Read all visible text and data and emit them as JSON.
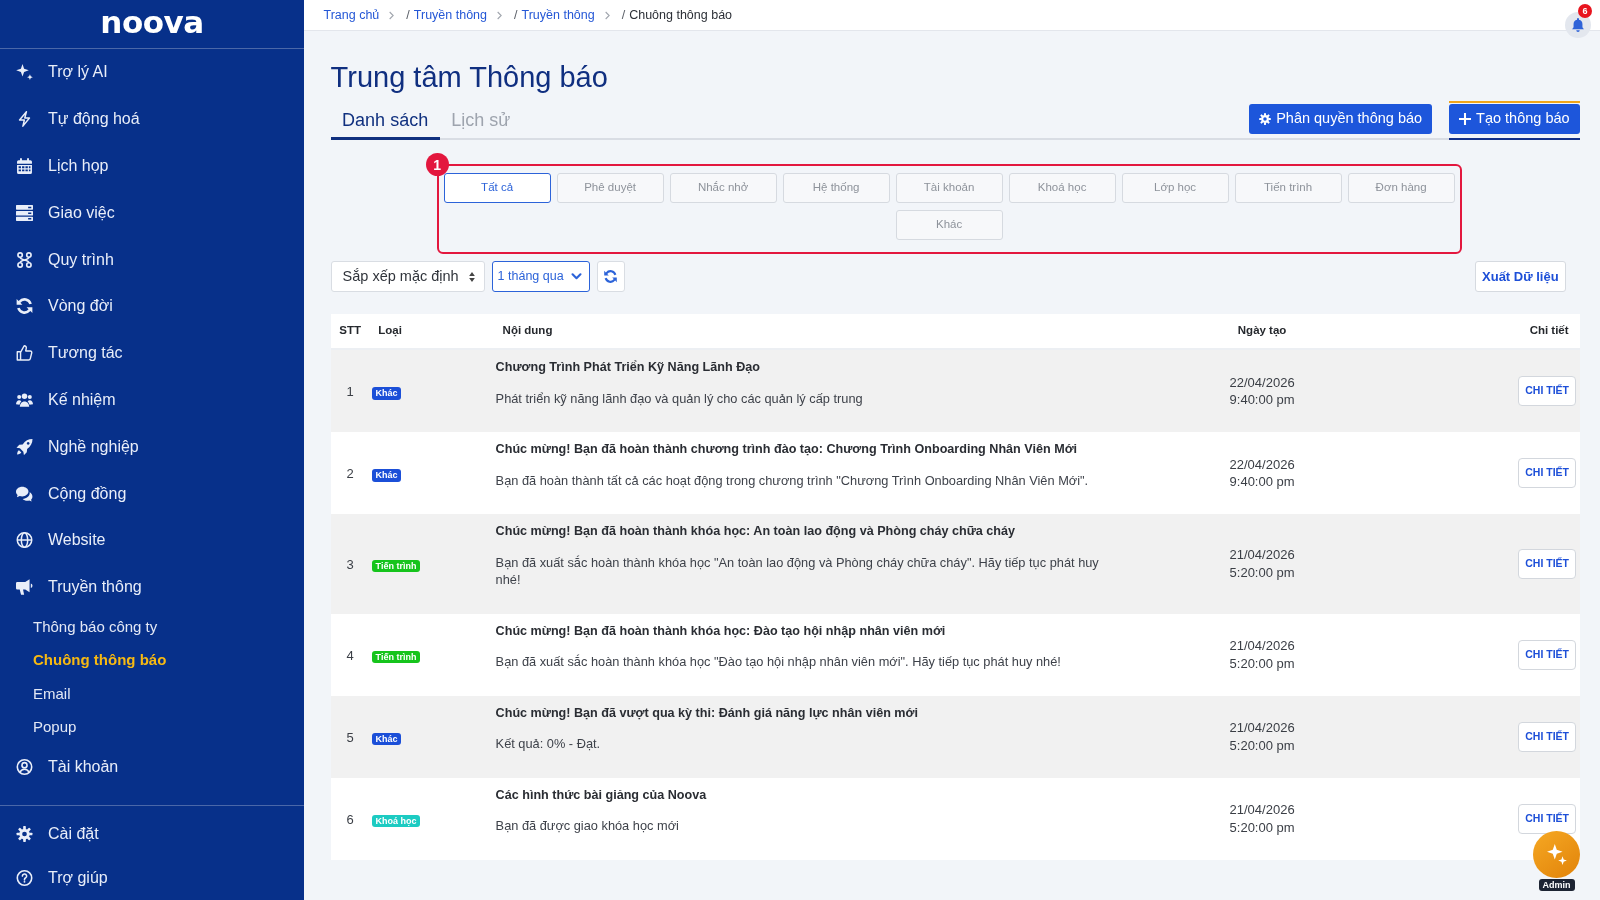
{
  "sidebar": {
    "logo": "noova",
    "items": [
      {
        "label": "Trợ lý AI",
        "selected": false
      },
      {
        "label": "Tự động hoá",
        "selected": false
      },
      {
        "label": "Lịch họp",
        "selected": false
      },
      {
        "label": "Giao việc",
        "selected": false
      },
      {
        "label": "Quy trình",
        "selected": false
      },
      {
        "label": "Vòng đời",
        "selected": false
      },
      {
        "label": "Tương tác",
        "selected": false
      },
      {
        "label": "Kế nhiệm",
        "selected": false
      },
      {
        "label": "Nghề nghiệp",
        "selected": false
      },
      {
        "label": "Cộng đồng",
        "selected": false
      },
      {
        "label": "Website",
        "selected": false
      },
      {
        "label": "Truyền thông",
        "selected": false,
        "children": [
          {
            "label": "Thông báo công ty",
            "selected": false
          },
          {
            "label": "Chuông thông báo",
            "selected": true
          },
          {
            "label": "Email",
            "selected": false
          },
          {
            "label": "Popup",
            "selected": false
          }
        ]
      },
      {
        "label": "Tài khoản",
        "selected": false
      }
    ],
    "bottom_items": [
      {
        "label": "Cài đặt",
        "selected": false
      },
      {
        "label": "Trợ giúp",
        "selected": false
      }
    ]
  },
  "breadcrumb": [
    {
      "label": "Trang chủ",
      "current": false
    },
    {
      "separator": "/",
      "label": "Truyền thông",
      "current": false
    },
    {
      "separator": "/",
      "label": "Truyền thông",
      "current": false
    },
    {
      "separator": "/",
      "label": "Chuông thông báo",
      "current": true
    }
  ],
  "notifications": {
    "count": "6"
  },
  "title": "Trung tâm Thông báo",
  "tabs": [
    {
      "label": "Danh sách",
      "selected": true
    },
    {
      "label": "Lịch sử",
      "selected": false
    }
  ],
  "actions": [
    {
      "label": "Phân quyền thông báo"
    },
    {
      "label": "Tạo thông báo"
    }
  ],
  "filter_panel": {
    "step": "1",
    "filters": [
      {
        "label": "Tất cả",
        "selected": true
      },
      {
        "label": "Phê duyệt",
        "selected": false
      },
      {
        "label": "Nhắc nhở",
        "selected": false
      },
      {
        "label": "Hệ thống",
        "selected": false
      },
      {
        "label": "Tài khoản",
        "selected": false
      },
      {
        "label": "Khoá học",
        "selected": false
      },
      {
        "label": "Lớp học",
        "selected": false
      },
      {
        "label": "Tiến trình",
        "selected": false
      },
      {
        "label": "Đơn hàng",
        "selected": false
      },
      {
        "label": "Khác",
        "selected": false
      }
    ]
  },
  "toolbar": {
    "sort": {
      "value": "Sắp xếp mặc định"
    },
    "period": {
      "value": "1 tháng qua"
    },
    "export_button": "Xuất Dữ liệu"
  },
  "table": {
    "columns": [
      "STT",
      "Loại",
      "Nội dung",
      "Ngày tạo",
      "Chi tiết"
    ],
    "rows": [
      {
        "number": "1",
        "type": {
          "label": "Khác",
          "color": "#1b4fd8"
        },
        "title": "Chương Trình Phát Triển Kỹ Năng Lãnh Đạo",
        "message": "Phát triển kỹ năng lãnh đạo và quản lý cho các quản lý cấp trung",
        "date": "22/04/2026",
        "time": "9:40:00 pm",
        "action": "CHI TIẾT"
      },
      {
        "number": "2",
        "type": {
          "label": "Khác",
          "color": "#1b4fd8"
        },
        "title": "Chúc mừng! Bạn đã hoàn thành chương trình đào tạo: Chương Trình Onboarding Nhân Viên Mới",
        "message": "Bạn đã hoàn thành tất cả các hoạt động trong chương trình \"Chương Trình Onboarding Nhân Viên Mới\".",
        "date": "22/04/2026",
        "time": "9:40:00 pm",
        "action": "CHI TIẾT"
      },
      {
        "number": "3",
        "type": {
          "label": "Tiến trình",
          "color": "#16c41c"
        },
        "title": "Chúc mừng! Bạn đã hoàn thành khóa học: An toàn lao động và Phòng cháy chữa cháy",
        "message": "Bạn đã xuất sắc hoàn thành khóa học \"An toàn lao động và Phòng cháy chữa cháy\". Hãy tiếp tục phát huy nhé!",
        "date": "21/04/2026",
        "time": "5:20:00 pm",
        "action": "CHI TIẾT"
      },
      {
        "number": "4",
        "type": {
          "label": "Tiến trình",
          "color": "#16c41c"
        },
        "title": "Chúc mừng! Bạn đã hoàn thành khóa học: Đào tạo hội nhập nhân viên mới",
        "message": "Bạn đã xuất sắc hoàn thành khóa học \"Đào tạo hội nhập nhân viên mới\". Hãy tiếp tục phát huy nhé!",
        "date": "21/04/2026",
        "time": "5:20:00 pm",
        "action": "CHI TIẾT"
      },
      {
        "number": "5",
        "type": {
          "label": "Khác",
          "color": "#1b4fd8"
        },
        "title": "Chúc mừng! Bạn đã vượt qua kỳ thi: Đánh giá năng lực nhân viên mới",
        "message": "Kết quả: 0% - Đạt.",
        "date": "21/04/2026",
        "time": "5:20:00 pm",
        "action": "CHI TIẾT"
      },
      {
        "number": "6",
        "type": {
          "label": "Khoá học",
          "color": "#1ccbc2"
        },
        "title": "Các hình thức bài giảng của Noova",
        "message": "Bạn đã được giao khóa học mới",
        "date": "21/04/2026",
        "time": "5:20:00 pm",
        "action": "CHI TIẾT"
      }
    ]
  },
  "assistant": {
    "badge": "Admin"
  }
}
